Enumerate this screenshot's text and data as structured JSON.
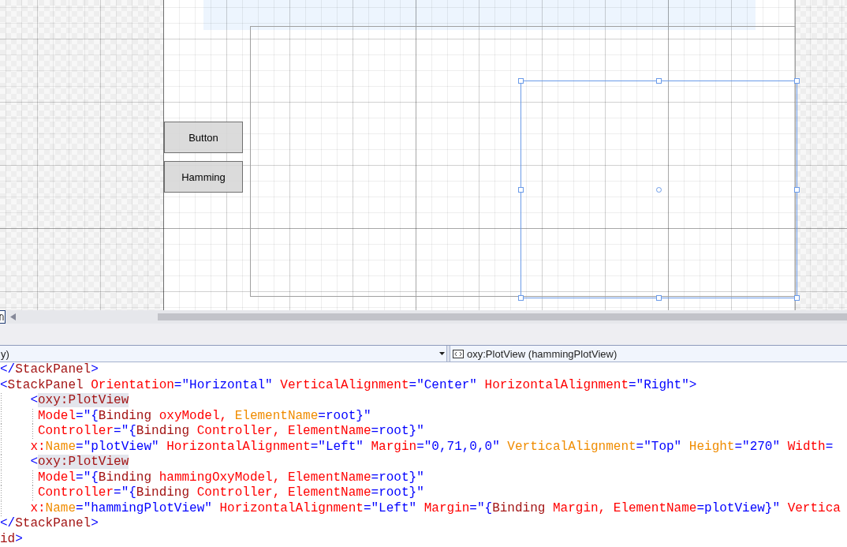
{
  "designer": {
    "buttons": [
      {
        "label": "Button"
      },
      {
        "label": "Hamming"
      }
    ],
    "frames": [
      {
        "selected": false
      },
      {
        "selected": true
      }
    ]
  },
  "selector_bar": {
    "left_dropdown": {
      "value": "y)"
    },
    "right_dropdown": {
      "value": "oxy:PlotView (hammingPlotView)"
    }
  },
  "xaml_editor": {
    "lines": [
      {
        "segments": [
          {
            "text": "</",
            "kind": "delimiter"
          },
          {
            "text": "StackPanel",
            "kind": "element"
          },
          {
            "text": ">",
            "kind": "delimiter"
          }
        ]
      },
      {
        "segments": [
          {
            "text": "<",
            "kind": "delimiter"
          },
          {
            "text": "StackPanel",
            "kind": "element"
          },
          {
            "text": " Orientation",
            "kind": "attribute"
          },
          {
            "text": "=",
            "kind": "delimiter"
          },
          {
            "text": "\"Horizontal\"",
            "kind": "value"
          },
          {
            "text": " VerticalAlignment",
            "kind": "attribute"
          },
          {
            "text": "=",
            "kind": "delimiter"
          },
          {
            "text": "\"Center\"",
            "kind": "value"
          },
          {
            "text": " HorizontalAlignment",
            "kind": "attribute"
          },
          {
            "text": "=",
            "kind": "delimiter"
          },
          {
            "text": "\"Right\"",
            "kind": "value"
          },
          {
            "text": ">",
            "kind": "delimiter"
          }
        ]
      },
      {
        "segments": [
          {
            "text": "    <",
            "kind": "delimiter"
          },
          {
            "text": "oxy:PlotView",
            "kind": "reference"
          }
        ]
      },
      {
        "segments": [
          {
            "text": "     Model",
            "kind": "attribute"
          },
          {
            "text": "=\"{",
            "kind": "delimiter"
          },
          {
            "text": "Binding",
            "kind": "extension"
          },
          {
            "text": " oxyModel, ",
            "kind": "attribute"
          },
          {
            "text": "ElementName",
            "kind": "accent"
          },
          {
            "text": "=",
            "kind": "delimiter"
          },
          {
            "text": "root",
            "kind": "value"
          },
          {
            "text": "}\"",
            "kind": "delimiter"
          }
        ]
      },
      {
        "segments": [
          {
            "text": "     Controller",
            "kind": "attribute"
          },
          {
            "text": "=\"{",
            "kind": "delimiter"
          },
          {
            "text": "Binding",
            "kind": "extension"
          },
          {
            "text": " Controller, ElementName",
            "kind": "attribute"
          },
          {
            "text": "=",
            "kind": "delimiter"
          },
          {
            "text": "root",
            "kind": "value"
          },
          {
            "text": "}\"",
            "kind": "delimiter"
          }
        ]
      },
      {
        "segments": [
          {
            "text": "    x:",
            "kind": "attribute"
          },
          {
            "text": "Name",
            "kind": "accent"
          },
          {
            "text": "=",
            "kind": "delimiter"
          },
          {
            "text": "\"plotView\"",
            "kind": "value"
          },
          {
            "text": " HorizontalAlignment",
            "kind": "attribute"
          },
          {
            "text": "=",
            "kind": "delimiter"
          },
          {
            "text": "\"Left\"",
            "kind": "value"
          },
          {
            "text": " Margin",
            "kind": "attribute"
          },
          {
            "text": "=",
            "kind": "delimiter"
          },
          {
            "text": "\"0,71,0,0\"",
            "kind": "value"
          },
          {
            "text": " VerticalAlignment",
            "kind": "accent"
          },
          {
            "text": "=",
            "kind": "delimiter"
          },
          {
            "text": "\"Top\"",
            "kind": "value"
          },
          {
            "text": " Height",
            "kind": "accent"
          },
          {
            "text": "=",
            "kind": "delimiter"
          },
          {
            "text": "\"270\"",
            "kind": "value"
          },
          {
            "text": " Width",
            "kind": "attribute"
          },
          {
            "text": "=",
            "kind": "delimiter"
          }
        ]
      },
      {
        "segments": [
          {
            "text": "    <",
            "kind": "delimiter"
          },
          {
            "text": "oxy:PlotView",
            "kind": "reference"
          }
        ]
      },
      {
        "segments": [
          {
            "text": "     Model",
            "kind": "attribute"
          },
          {
            "text": "=\"{",
            "kind": "delimiter"
          },
          {
            "text": "Binding",
            "kind": "extension"
          },
          {
            "text": " hammingOxyModel, ElementName",
            "kind": "attribute"
          },
          {
            "text": "=",
            "kind": "delimiter"
          },
          {
            "text": "root",
            "kind": "value"
          },
          {
            "text": "}\"",
            "kind": "delimiter"
          }
        ]
      },
      {
        "segments": [
          {
            "text": "     Controller",
            "kind": "attribute"
          },
          {
            "text": "=\"{",
            "kind": "delimiter"
          },
          {
            "text": "Binding",
            "kind": "extension"
          },
          {
            "text": " Controller, ElementName",
            "kind": "attribute"
          },
          {
            "text": "=",
            "kind": "delimiter"
          },
          {
            "text": "root",
            "kind": "value"
          },
          {
            "text": "}\"",
            "kind": "delimiter"
          }
        ]
      },
      {
        "segments": [
          {
            "text": "    x:",
            "kind": "attribute"
          },
          {
            "text": "Name",
            "kind": "accent"
          },
          {
            "text": "=",
            "kind": "delimiter"
          },
          {
            "text": "\"hammingPlotView\"",
            "kind": "value"
          },
          {
            "text": " HorizontalAlignment",
            "kind": "attribute"
          },
          {
            "text": "=",
            "kind": "delimiter"
          },
          {
            "text": "\"Left\"",
            "kind": "value"
          },
          {
            "text": " Margin",
            "kind": "attribute"
          },
          {
            "text": "=\"{",
            "kind": "delimiter"
          },
          {
            "text": "Binding",
            "kind": "extension"
          },
          {
            "text": " Margin, ElementName",
            "kind": "attribute"
          },
          {
            "text": "=",
            "kind": "delimiter"
          },
          {
            "text": "plotView",
            "kind": "value"
          },
          {
            "text": "}\"",
            "kind": "delimiter"
          },
          {
            "text": " Vertica",
            "kind": "attribute"
          }
        ]
      },
      {
        "segments": [
          {
            "text": "</",
            "kind": "delimiter"
          },
          {
            "text": "StackPanel",
            "kind": "element"
          },
          {
            "text": ">",
            "kind": "delimiter"
          }
        ]
      },
      {
        "segments": [
          {
            "text": "id",
            "kind": "element"
          },
          {
            "text": ">",
            "kind": "delimiter"
          }
        ]
      }
    ]
  }
}
